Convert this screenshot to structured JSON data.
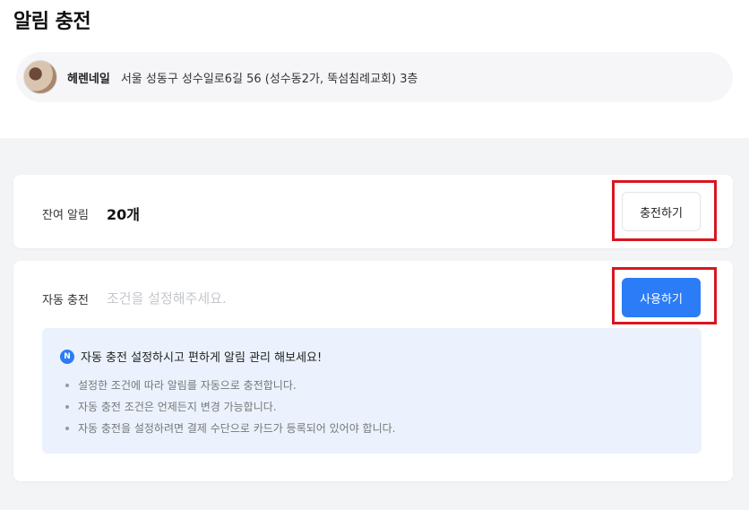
{
  "page": {
    "title": "알림 충전"
  },
  "shop": {
    "name": "헤렌네일",
    "address": "서울 성동구 성수일로6길 56 (성수동2가, 뚝섬침례교회) 3층"
  },
  "remaining": {
    "label": "잔여 알림",
    "value": "20개",
    "button_label": "충전하기"
  },
  "auto_charge": {
    "label": "자동 충전",
    "placeholder": "조건을 설정해주세요.",
    "button_label": "사용하기",
    "info": {
      "badge": "N",
      "title": "자동 충전 설정하시고 편하게 알림 관리 해보세요!",
      "items": [
        "설정한 조건에 따라 알림를 자동으로 충전합니다.",
        "자동 충전 조건은 언제든지 변경 가능합니다.",
        "자동 충전을 설정하려면 결제 수단으로 카드가 등록되어 있어야 합니다."
      ]
    }
  },
  "colors": {
    "accent": "#2b7cf6",
    "highlight": "#d8161e",
    "info_bg": "#ebf2fd",
    "section_bg": "#f3f4f6"
  }
}
